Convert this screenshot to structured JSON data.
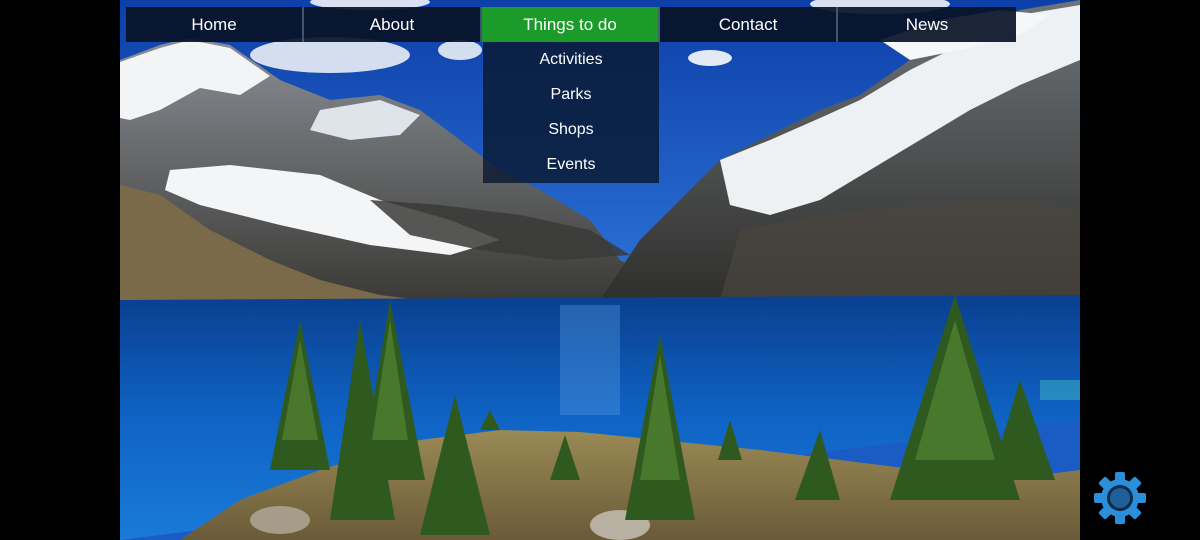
{
  "nav": {
    "items": [
      {
        "label": "Home"
      },
      {
        "label": "About"
      },
      {
        "label": "Things to do"
      },
      {
        "label": "Contact"
      },
      {
        "label": "News"
      }
    ]
  },
  "dropdown": {
    "items": [
      {
        "label": "Activities"
      },
      {
        "label": "Parks"
      },
      {
        "label": "Shops"
      },
      {
        "label": "Events"
      }
    ]
  },
  "colors": {
    "nav_background": "#081226",
    "nav_active": "#1b9b2a",
    "dropdown_background": "#0a1830",
    "gear": "#2a8fd8"
  },
  "icons": {
    "settings": "gear-icon"
  }
}
